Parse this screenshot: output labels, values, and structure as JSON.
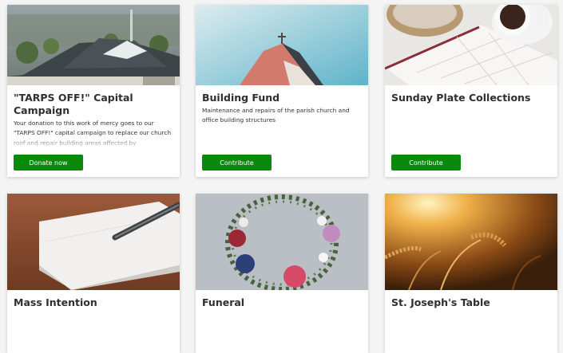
{
  "cards": [
    {
      "title": "\"TARPS OFF!\" Capital Campaign",
      "description": "Your donation to this work of mercy goes to our \"TARPS OFF!\" capital campaign to replace our church roof and repair building areas affected by",
      "button": "Donate now",
      "image": "church-rooftop-photo"
    },
    {
      "title": "Building Fund",
      "description": "Maintenance and repairs of the parish church and office building structures",
      "button": "Contribute",
      "image": "steeple-sky-photo"
    },
    {
      "title": "Sunday Plate Collections",
      "description": "",
      "button": "Contribute",
      "image": "calendar-coffee-photo"
    },
    {
      "title": "Mass Intention",
      "image": "notebook-pen-photo"
    },
    {
      "title": "Funeral",
      "image": "flower-wreath-photo"
    },
    {
      "title": "St. Joseph's Table",
      "image": "wheat-field-sunset-photo"
    }
  ],
  "colors": {
    "button": "#0a8a0a",
    "page_background": "#f4f4f4"
  }
}
